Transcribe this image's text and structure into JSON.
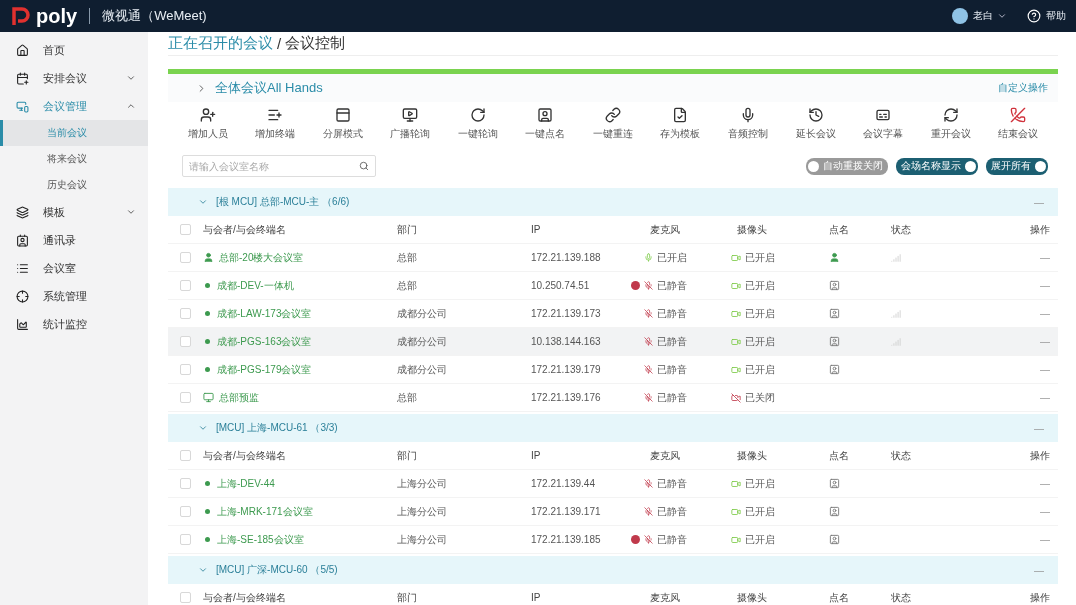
{
  "topbar": {
    "brand": "poly",
    "app_title": "微视通（WeMeet)",
    "user": "老白",
    "help": "帮助"
  },
  "sidebar": {
    "items": [
      {
        "label": "首页",
        "selected": false
      },
      {
        "label": "安排会议",
        "expanded": false,
        "selected": false
      },
      {
        "label": "会议管理",
        "expanded": true,
        "selected": true,
        "children": [
          {
            "label": "当前会议",
            "selected": true
          },
          {
            "label": "将来会议",
            "selected": false
          },
          {
            "label": "历史会议",
            "selected": false
          }
        ]
      },
      {
        "label": "模板",
        "expanded": false,
        "selected": false
      },
      {
        "label": "通讯录",
        "selected": false
      },
      {
        "label": "会议室",
        "selected": false
      },
      {
        "label": "系统管理",
        "selected": false
      },
      {
        "label": "统计监控",
        "selected": false
      }
    ]
  },
  "breadcrumb": {
    "parent": "正在召开的会议",
    "separator": "/",
    "current": "会议控制"
  },
  "conference": {
    "title": "全体会议All Hands",
    "custom_action": "自定义操作",
    "toolbar": [
      {
        "label": "增加人员",
        "kind": "add-person"
      },
      {
        "label": "增加终端",
        "kind": "add-terminal"
      },
      {
        "label": "分屏模式",
        "kind": "split"
      },
      {
        "label": "广播轮询",
        "kind": "broadcast"
      },
      {
        "label": "一键轮询",
        "kind": "poll"
      },
      {
        "label": "一键点名",
        "kind": "rollcall"
      },
      {
        "label": "一键重连",
        "kind": "reconnect"
      },
      {
        "label": "存为模板",
        "kind": "template"
      },
      {
        "label": "音频控制",
        "kind": "audio"
      },
      {
        "label": "延长会议",
        "kind": "extend"
      },
      {
        "label": "会议字幕",
        "kind": "caption"
      },
      {
        "label": "重开会议",
        "kind": "restart"
      },
      {
        "label": "结束会议",
        "kind": "end"
      }
    ],
    "search": {
      "placeholder": "请输入会议室名称"
    },
    "toggles": [
      {
        "label": "自动重拨关闭",
        "on": false
      },
      {
        "label": "会场名称显示",
        "on": true
      },
      {
        "label": "展开所有",
        "on": true
      }
    ]
  },
  "groups": [
    {
      "title": "[根 MCU] 总部-MCU-主 （6/6)",
      "expanded": true,
      "action": "—",
      "all_checked": false,
      "columns": [
        "与会者/与会终端名",
        "部门",
        "IP",
        "麦克风",
        "摄像头",
        "点名",
        "状态",
        "操作"
      ],
      "rows": [
        {
          "name": "总部-20楼大会议室",
          "kind": "chair",
          "dept": "总部",
          "ip": "172.21.139.188",
          "mic": {
            "text": "已开启",
            "muted": false,
            "alert": false
          },
          "camera": {
            "text": "已开启",
            "on": true
          },
          "signal": true,
          "hovered": false,
          "checked": false,
          "action": "—"
        },
        {
          "name": "成都-DEV-一体机",
          "kind": "dot",
          "dept": "总部",
          "ip": "10.250.74.51",
          "mic": {
            "text": "已静音",
            "muted": true,
            "alert": true
          },
          "camera": {
            "text": "已开启",
            "on": true
          },
          "signal": false,
          "hovered": false,
          "checked": false,
          "action": "—"
        },
        {
          "name": "成都-LAW-173会议室",
          "kind": "dot",
          "dept": "成都分公司",
          "ip": "172.21.139.173",
          "mic": {
            "text": "已静音",
            "muted": true,
            "alert": false
          },
          "camera": {
            "text": "已开启",
            "on": true
          },
          "signal": true,
          "hovered": false,
          "checked": false,
          "action": "—"
        },
        {
          "name": "成都-PGS-163会议室",
          "kind": "dot",
          "dept": "成都分公司",
          "ip": "10.138.144.163",
          "mic": {
            "text": "已静音",
            "muted": true,
            "alert": false
          },
          "camera": {
            "text": "已开启",
            "on": true
          },
          "signal": true,
          "hovered": true,
          "checked": false,
          "action": "—"
        },
        {
          "name": "成都-PGS-179会议室",
          "kind": "dot",
          "dept": "成都分公司",
          "ip": "172.21.139.179",
          "mic": {
            "text": "已静音",
            "muted": true,
            "alert": false
          },
          "camera": {
            "text": "已开启",
            "on": true
          },
          "signal": false,
          "hovered": false,
          "checked": false,
          "action": "—"
        },
        {
          "name": "总部预监",
          "kind": "monitor",
          "dept": "总部",
          "ip": "172.21.139.176",
          "mic": {
            "text": "已静音",
            "muted": true,
            "alert": false
          },
          "camera": {
            "text": "已关闭",
            "on": false
          },
          "signal": false,
          "hovered": false,
          "checked": false,
          "action": "—"
        }
      ]
    },
    {
      "title": "[MCU] 上海-MCU-61 （3/3)",
      "expanded": true,
      "action": "—",
      "all_checked": false,
      "columns": [
        "与会者/与会终端名",
        "部门",
        "IP",
        "麦克风",
        "摄像头",
        "点名",
        "状态",
        "操作"
      ],
      "rows": [
        {
          "name": "上海-DEV-44",
          "kind": "dot",
          "dept": "上海分公司",
          "ip": "172.21.139.44",
          "mic": {
            "text": "已静音",
            "muted": true,
            "alert": false
          },
          "camera": {
            "text": "已开启",
            "on": true
          },
          "signal": false,
          "hovered": false,
          "checked": false,
          "action": "—"
        },
        {
          "name": "上海-MRK-171会议室",
          "kind": "dot",
          "dept": "上海分公司",
          "ip": "172.21.139.171",
          "mic": {
            "text": "已静音",
            "muted": true,
            "alert": false
          },
          "camera": {
            "text": "已开启",
            "on": true
          },
          "signal": false,
          "hovered": false,
          "checked": false,
          "action": "—"
        },
        {
          "name": "上海-SE-185会议室",
          "kind": "dot",
          "dept": "上海分公司",
          "ip": "172.21.139.185",
          "mic": {
            "text": "已静音",
            "muted": true,
            "alert": true
          },
          "camera": {
            "text": "已开启",
            "on": true
          },
          "signal": false,
          "hovered": false,
          "checked": false,
          "action": "—"
        }
      ]
    },
    {
      "title": "[MCU] 广深-MCU-60 （5/5)",
      "expanded": true,
      "action": "—",
      "all_checked": false,
      "columns": [
        "与会者/与会终端名",
        "部门",
        "IP",
        "麦克风",
        "摄像头",
        "点名",
        "状态",
        "操作"
      ]
    }
  ]
}
